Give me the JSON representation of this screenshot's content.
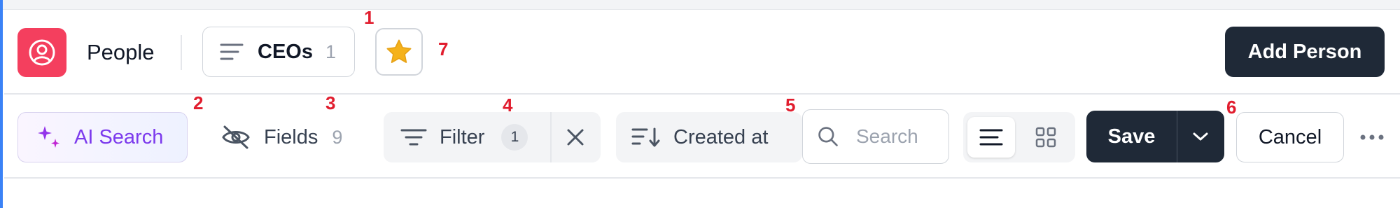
{
  "header": {
    "title": "People",
    "view": {
      "label": "CEOs",
      "count": "1"
    },
    "add_button": "Add Person"
  },
  "toolbar": {
    "ai_search": "AI Search",
    "fields": {
      "label": "Fields",
      "count": "9"
    },
    "filter": {
      "label": "Filter",
      "count": "1"
    },
    "sort": {
      "label": "Created at"
    },
    "search": {
      "placeholder": "Search"
    },
    "save": "Save",
    "cancel": "Cancel"
  },
  "markers": [
    "1",
    "2",
    "3",
    "4",
    "5",
    "6",
    "7"
  ],
  "icons": {
    "app": "user-circle-icon",
    "view": "list-lines-icon",
    "favorite": "star-icon",
    "ai": "sparkles-icon",
    "fields": "eye-off-icon",
    "filter": "filter-lines-icon",
    "clear": "close-icon",
    "sort": "sort-descending-icon",
    "search": "search-icon",
    "list_view": "list-view-icon",
    "grid_view": "grid-view-icon",
    "caret": "chevron-down-icon",
    "more": "more-horizontal-icon"
  },
  "colors": {
    "brand": "#f43f5e",
    "primary_dark": "#1f2937",
    "ai_accent": "#7c3aed",
    "star": "#f5b21b",
    "marker": "#e11d2e"
  }
}
